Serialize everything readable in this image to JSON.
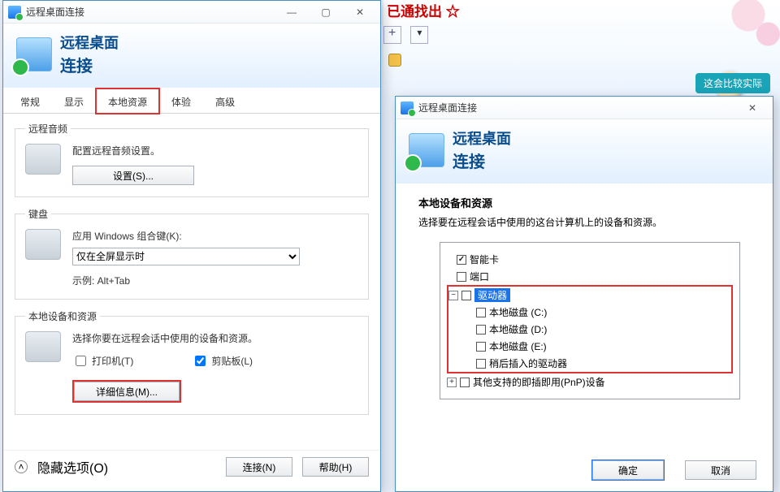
{
  "backgroundTruncated": "已通找出 ☆",
  "chatBubble": "这会比较实际",
  "winLeft": {
    "title": "远程桌面连接",
    "banner": {
      "l1": "远程桌面",
      "l2": "连接"
    },
    "tabs": [
      "常规",
      "显示",
      "本地资源",
      "体验",
      "高级"
    ],
    "activeTab": 2,
    "audio": {
      "legend": "远程音频",
      "text": "配置远程音频设置。",
      "btn": "设置(S)..."
    },
    "keyboard": {
      "legend": "键盘",
      "label": "应用 Windows 组合键(K):",
      "value": "仅在全屏显示时",
      "example": "示例: Alt+Tab"
    },
    "localdev": {
      "legend": "本地设备和资源",
      "text": "选择你要在远程会话中使用的设备和资源。",
      "printers": "打印机(T)",
      "clipboard": "剪贴板(L)",
      "moreBtn": "详细信息(M)..."
    },
    "footer": {
      "hide": "隐藏选项(O)",
      "connect": "连接(N)",
      "help": "帮助(H)"
    }
  },
  "winRight": {
    "title": "远程桌面连接",
    "banner": {
      "l1": "远程桌面",
      "l2": "连接"
    },
    "section": {
      "head": "本地设备和资源",
      "text": "选择要在远程会话中使用的这台计算机上的设备和资源。"
    },
    "tree": {
      "smartcard": "智能卡",
      "ports": "端口",
      "drives": "驱动器",
      "c": "本地磁盘 (C:)",
      "d": "本地磁盘 (D:)",
      "e": "本地磁盘 (E:)",
      "later": "稍后插入的驱动器",
      "pnp": "其他支持的即插即用(PnP)设备"
    },
    "ok": "确定",
    "cancel": "取消"
  }
}
